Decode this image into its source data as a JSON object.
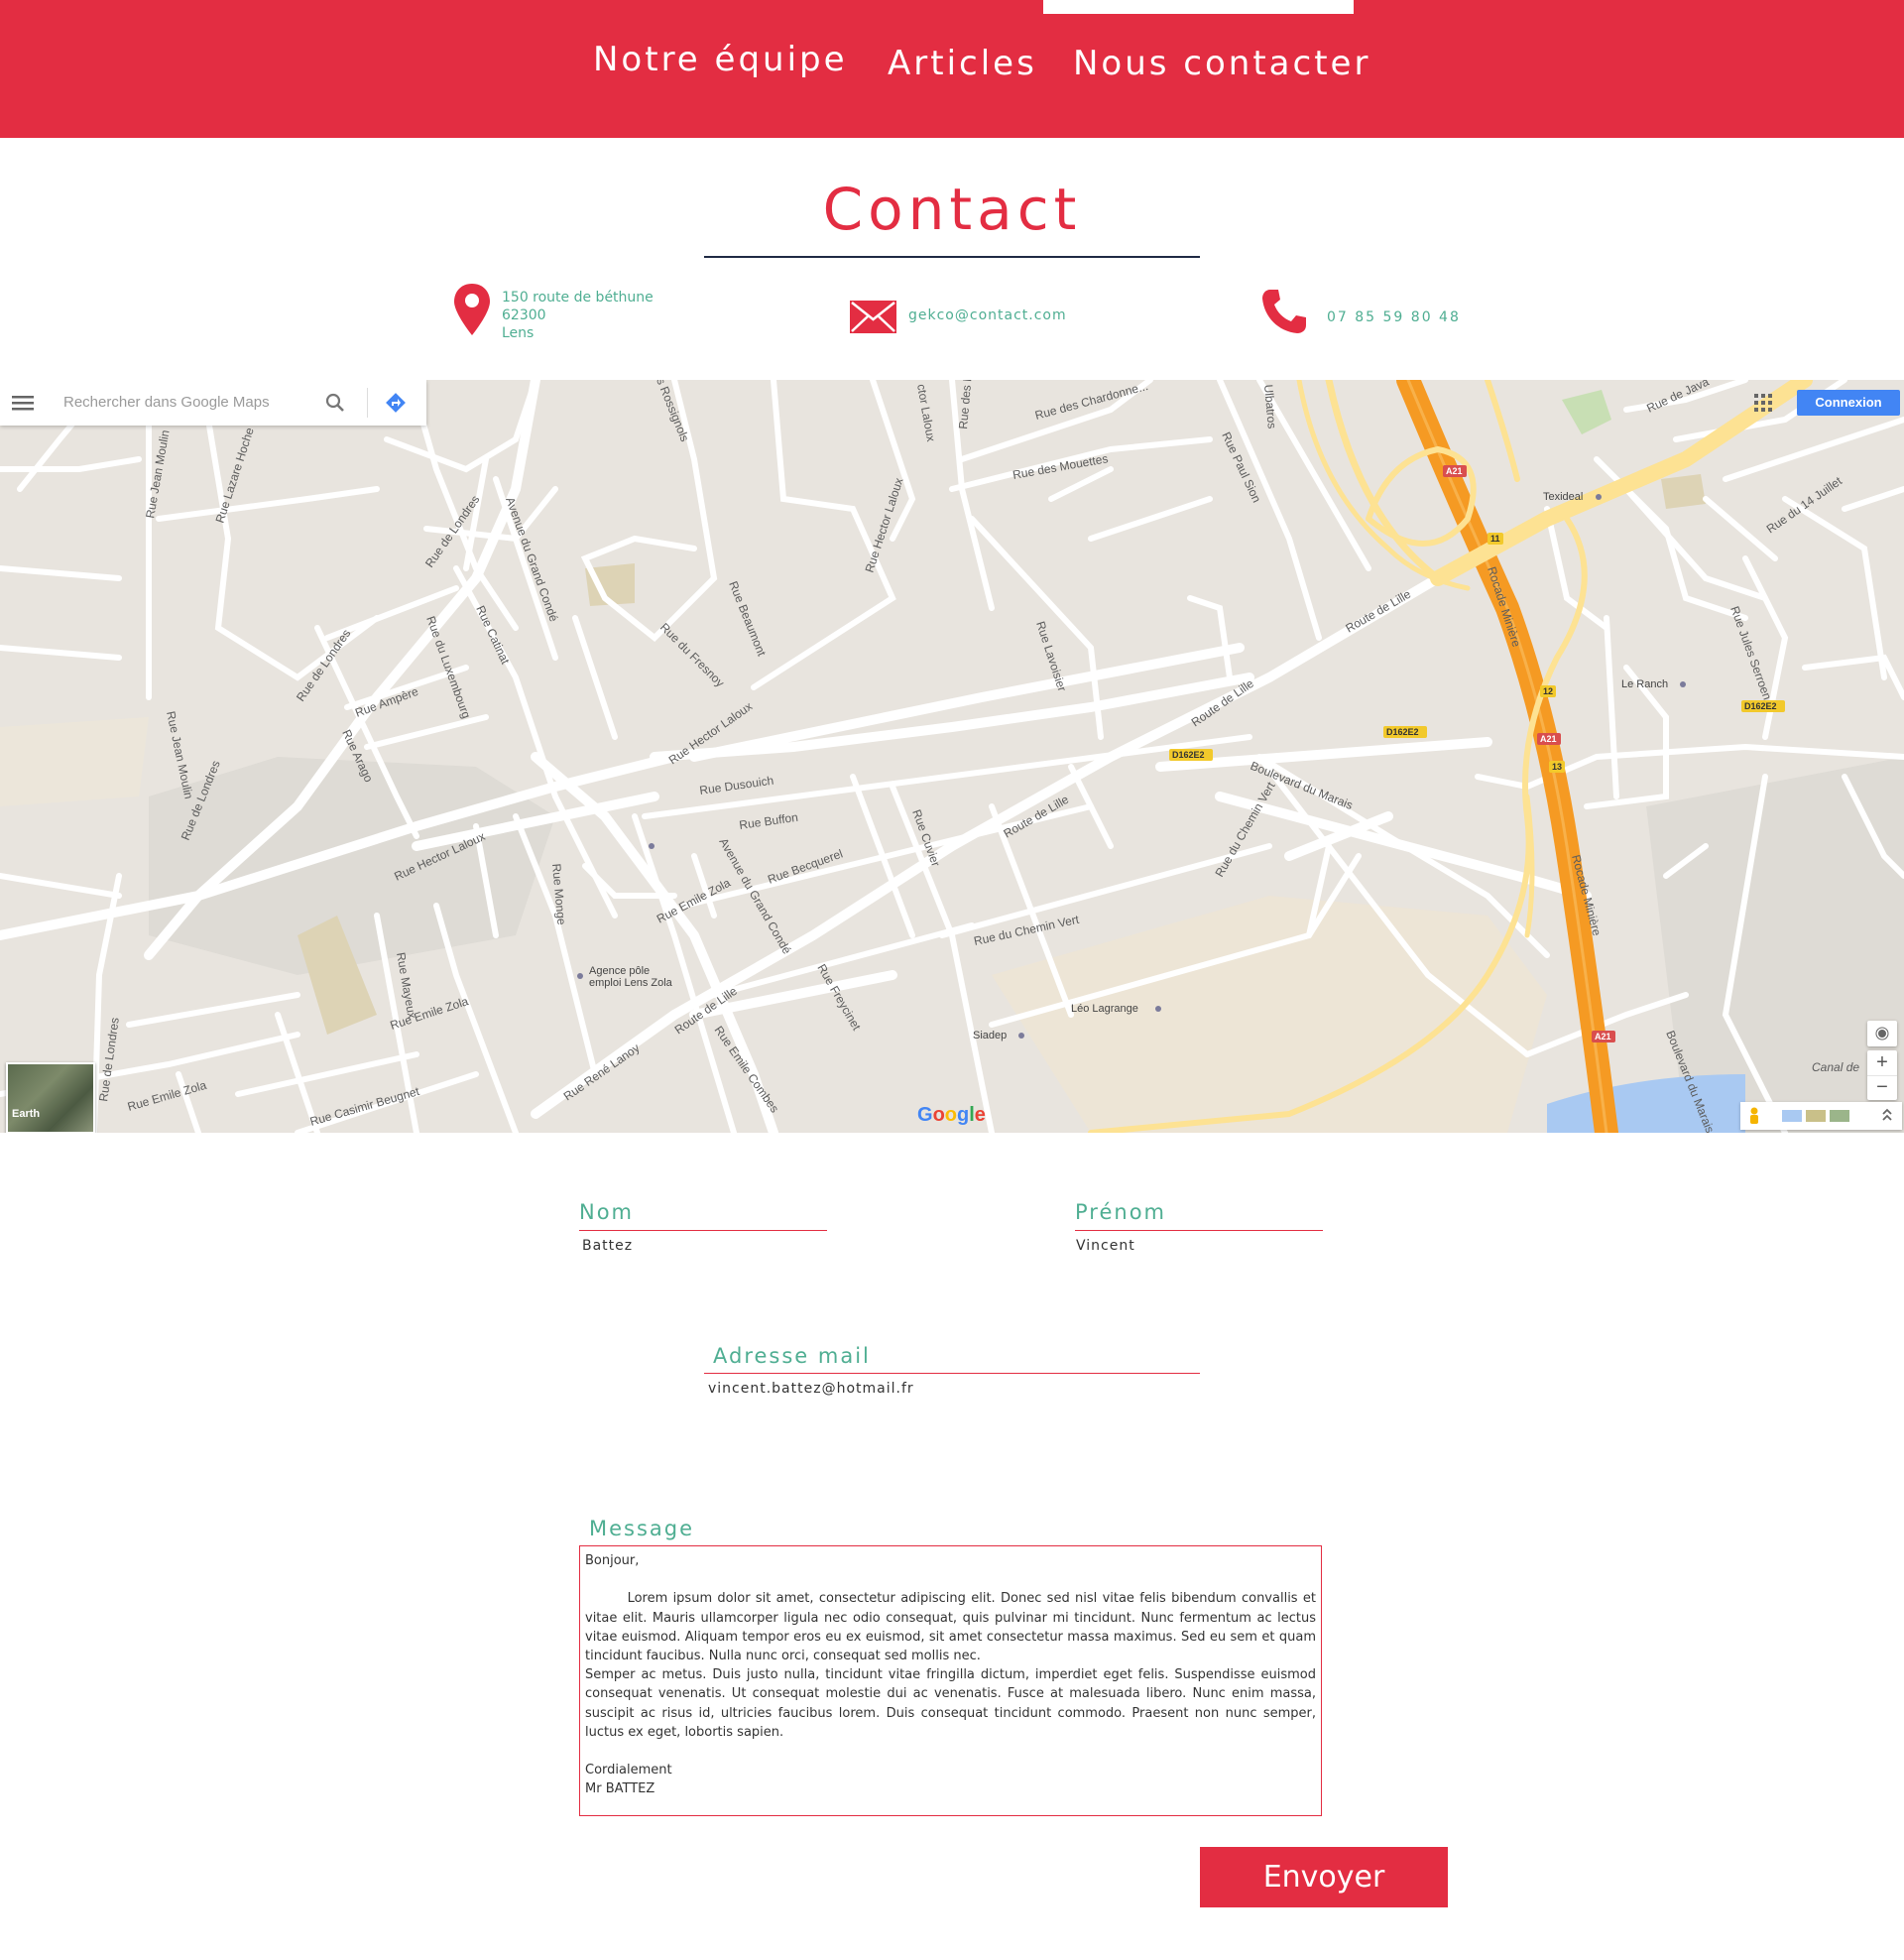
{
  "nav": {
    "items": [
      {
        "label": "Notre équipe"
      },
      {
        "label": "Articles"
      },
      {
        "label": "Nous contacter"
      }
    ],
    "active": "Nous contacter"
  },
  "contact": {
    "title": "Contact",
    "address": {
      "line1": "150 route de béthune",
      "line2": "62300",
      "line3": "Lens",
      "icon": "location-pin-icon"
    },
    "email": {
      "value": "gekco@contact.com",
      "icon": "envelope-icon"
    },
    "phone": {
      "value": "07 85 59 80 48",
      "icon": "phone-icon"
    }
  },
  "map": {
    "search_placeholder": "Rechercher dans Google Maps",
    "login_label": "Connexion",
    "earth_label": "Earth",
    "zoom_in": "+",
    "zoom_out": "−",
    "google_logo": [
      "G",
      "o",
      "o",
      "g",
      "l",
      "e"
    ],
    "streets": {
      "rue_jean_moulin_1": "Rue Jean Moulin",
      "rue_lazare_hoche": "Rue Lazare Hoche",
      "rue_de_londres_1": "Rue de Londres",
      "avenue_grand_conde_1": "Avenue du Grand Condé",
      "rossignols": "s Rossignols",
      "rue_hector_laloux_top": "ctor Laloux",
      "rue_des_b": "Rue des B",
      "rue_des_chardonnerets": "Rue des Chardonne...",
      "rue_des_mouettes": "Rue des Mouettes",
      "ulbatros": "Ulbatros",
      "rue_paul_sion": "Rue Paul Sion",
      "rue_de_java": "Rue de Java",
      "rue_du_14_juillet": "Rue du 14 Juillet",
      "rue_hector_laloux_mid": "Rue Hector Laloux",
      "rue_beaumont": "Rue Beaumont",
      "rue_du_fresnoy": "Rue du Fresnoy",
      "rue_catinat": "Rue Catinat",
      "rue_du_luxembourg": "Rue du Luxembourg",
      "rue_de_londres_2": "Rue de Londres",
      "rue_ampere": "Rue Ampère",
      "rue_arago": "Rue Arago",
      "rue_jean_moulin_2": "Rue Jean Moulin",
      "rue_de_londres_3": "Rue de Londres",
      "rue_lavoisier": "Rue Lavoisier",
      "route_de_lille_1": "Route de Lille",
      "route_de_lille_2": "Route de Lille",
      "rocade_miniere_1": "Rocade Minière",
      "rue_jules_serroen": "Rue Jules Serroen",
      "rue_hector_laloux_2": "Rue Hector Laloux",
      "rue_dusouich": "Rue Dusouich",
      "rue_buffon": "Rue Buffon",
      "rue_cuvier": "Rue Cuvier",
      "route_de_lille_3": "Route de Lille",
      "boulevard_du_marais": "Boulevard du Marais",
      "rue_du_chemin_vert_1": "Rue du Chemin Vert",
      "rocade_miniere_2": "Rocade Minière",
      "rue_hector_laloux_3": "Rue Hector Laloux",
      "rue_monge": "Rue Monge",
      "avenue_grand_conde_2": "Avenue du Grand Condé",
      "rue_becquerel": "Rue Becquerel",
      "rue_emile_zola_1": "Rue Emile Zola",
      "rue_mayeux": "Rue Mayeux",
      "rue_emile_zola_2": "Rue Emile Zola",
      "rue_du_chemin_vert_2": "Rue du Chemin Vert",
      "rue_freycinet": "Rue Freycinet",
      "route_de_lille_4": "Route de Lille",
      "rue_emile_combes": "Rue Emile Combes",
      "rue_rene_lanoy": "Rue René Lanoy",
      "rue_de_londres_4": "Rue de Londres",
      "rue_emile_zola_3": "Rue Emile Zola",
      "rue_casimir_beugnet": "Rue Casimir Beugnet",
      "boulevard_du_marais_2": "Boulevard du Marais",
      "canal_de": "Canal de"
    },
    "places": {
      "texideal": "Texideal",
      "le_ranch": "Le Ranch",
      "agence_pole_1": "Agence pôle",
      "agence_pole_2": "emploi Lens Zola",
      "leo_lagrange": "Léo Lagrange",
      "siadep": "Siadep"
    },
    "shields": {
      "a21": "A21",
      "e11": "11",
      "e12": "12",
      "e13": "13",
      "d162e2": "D162E2"
    }
  },
  "form": {
    "nom": {
      "label": "Nom",
      "value": "Battez"
    },
    "prenom": {
      "label": "Prénom",
      "value": "Vincent"
    },
    "email": {
      "label": "Adresse mail",
      "value": "vincent.battez@hotmail.fr"
    },
    "message": {
      "label": "Message",
      "value": "Bonjour,\n\n        Lorem ipsum dolor sit amet, consectetur adipiscing elit. Donec sed nisl vitae felis bibendum convallis et vitae elit. Mauris ullamcorper ligula nec odio consequat, quis pulvinar mi tincidunt. Nunc fermentum ac lectus vitae euismod. Aliquam tempor eros eu ex euismod, sit amet consectetur massa maximus. Sed eu sem et quam tincidunt faucibus. Nulla nunc orci, consequat sed mollis nec.\nSemper ac metus. Duis justo nulla, tincidunt vitae fringilla dictum, imperdiet eget felis. Suspendisse euismod consequat venenatis. Ut consequat molestie dui ac venenatis. Fusce at malesuada libero. Nunc enim massa, suscipit ac risus id, ultricies faucibus lorem. Duis consequat tincidunt commodo. Praesent non nunc semper, luctus ex eget, lobortis sapien.\n\nCordialement\nMr BATTEZ"
    },
    "submit_label": "Envoyer"
  },
  "colors": {
    "brand_red": "#e32d42",
    "accent_green": "#4fae92",
    "title_rule": "#1f2a44",
    "map_motorway": "#f59a23",
    "map_primary": "#fde293"
  }
}
